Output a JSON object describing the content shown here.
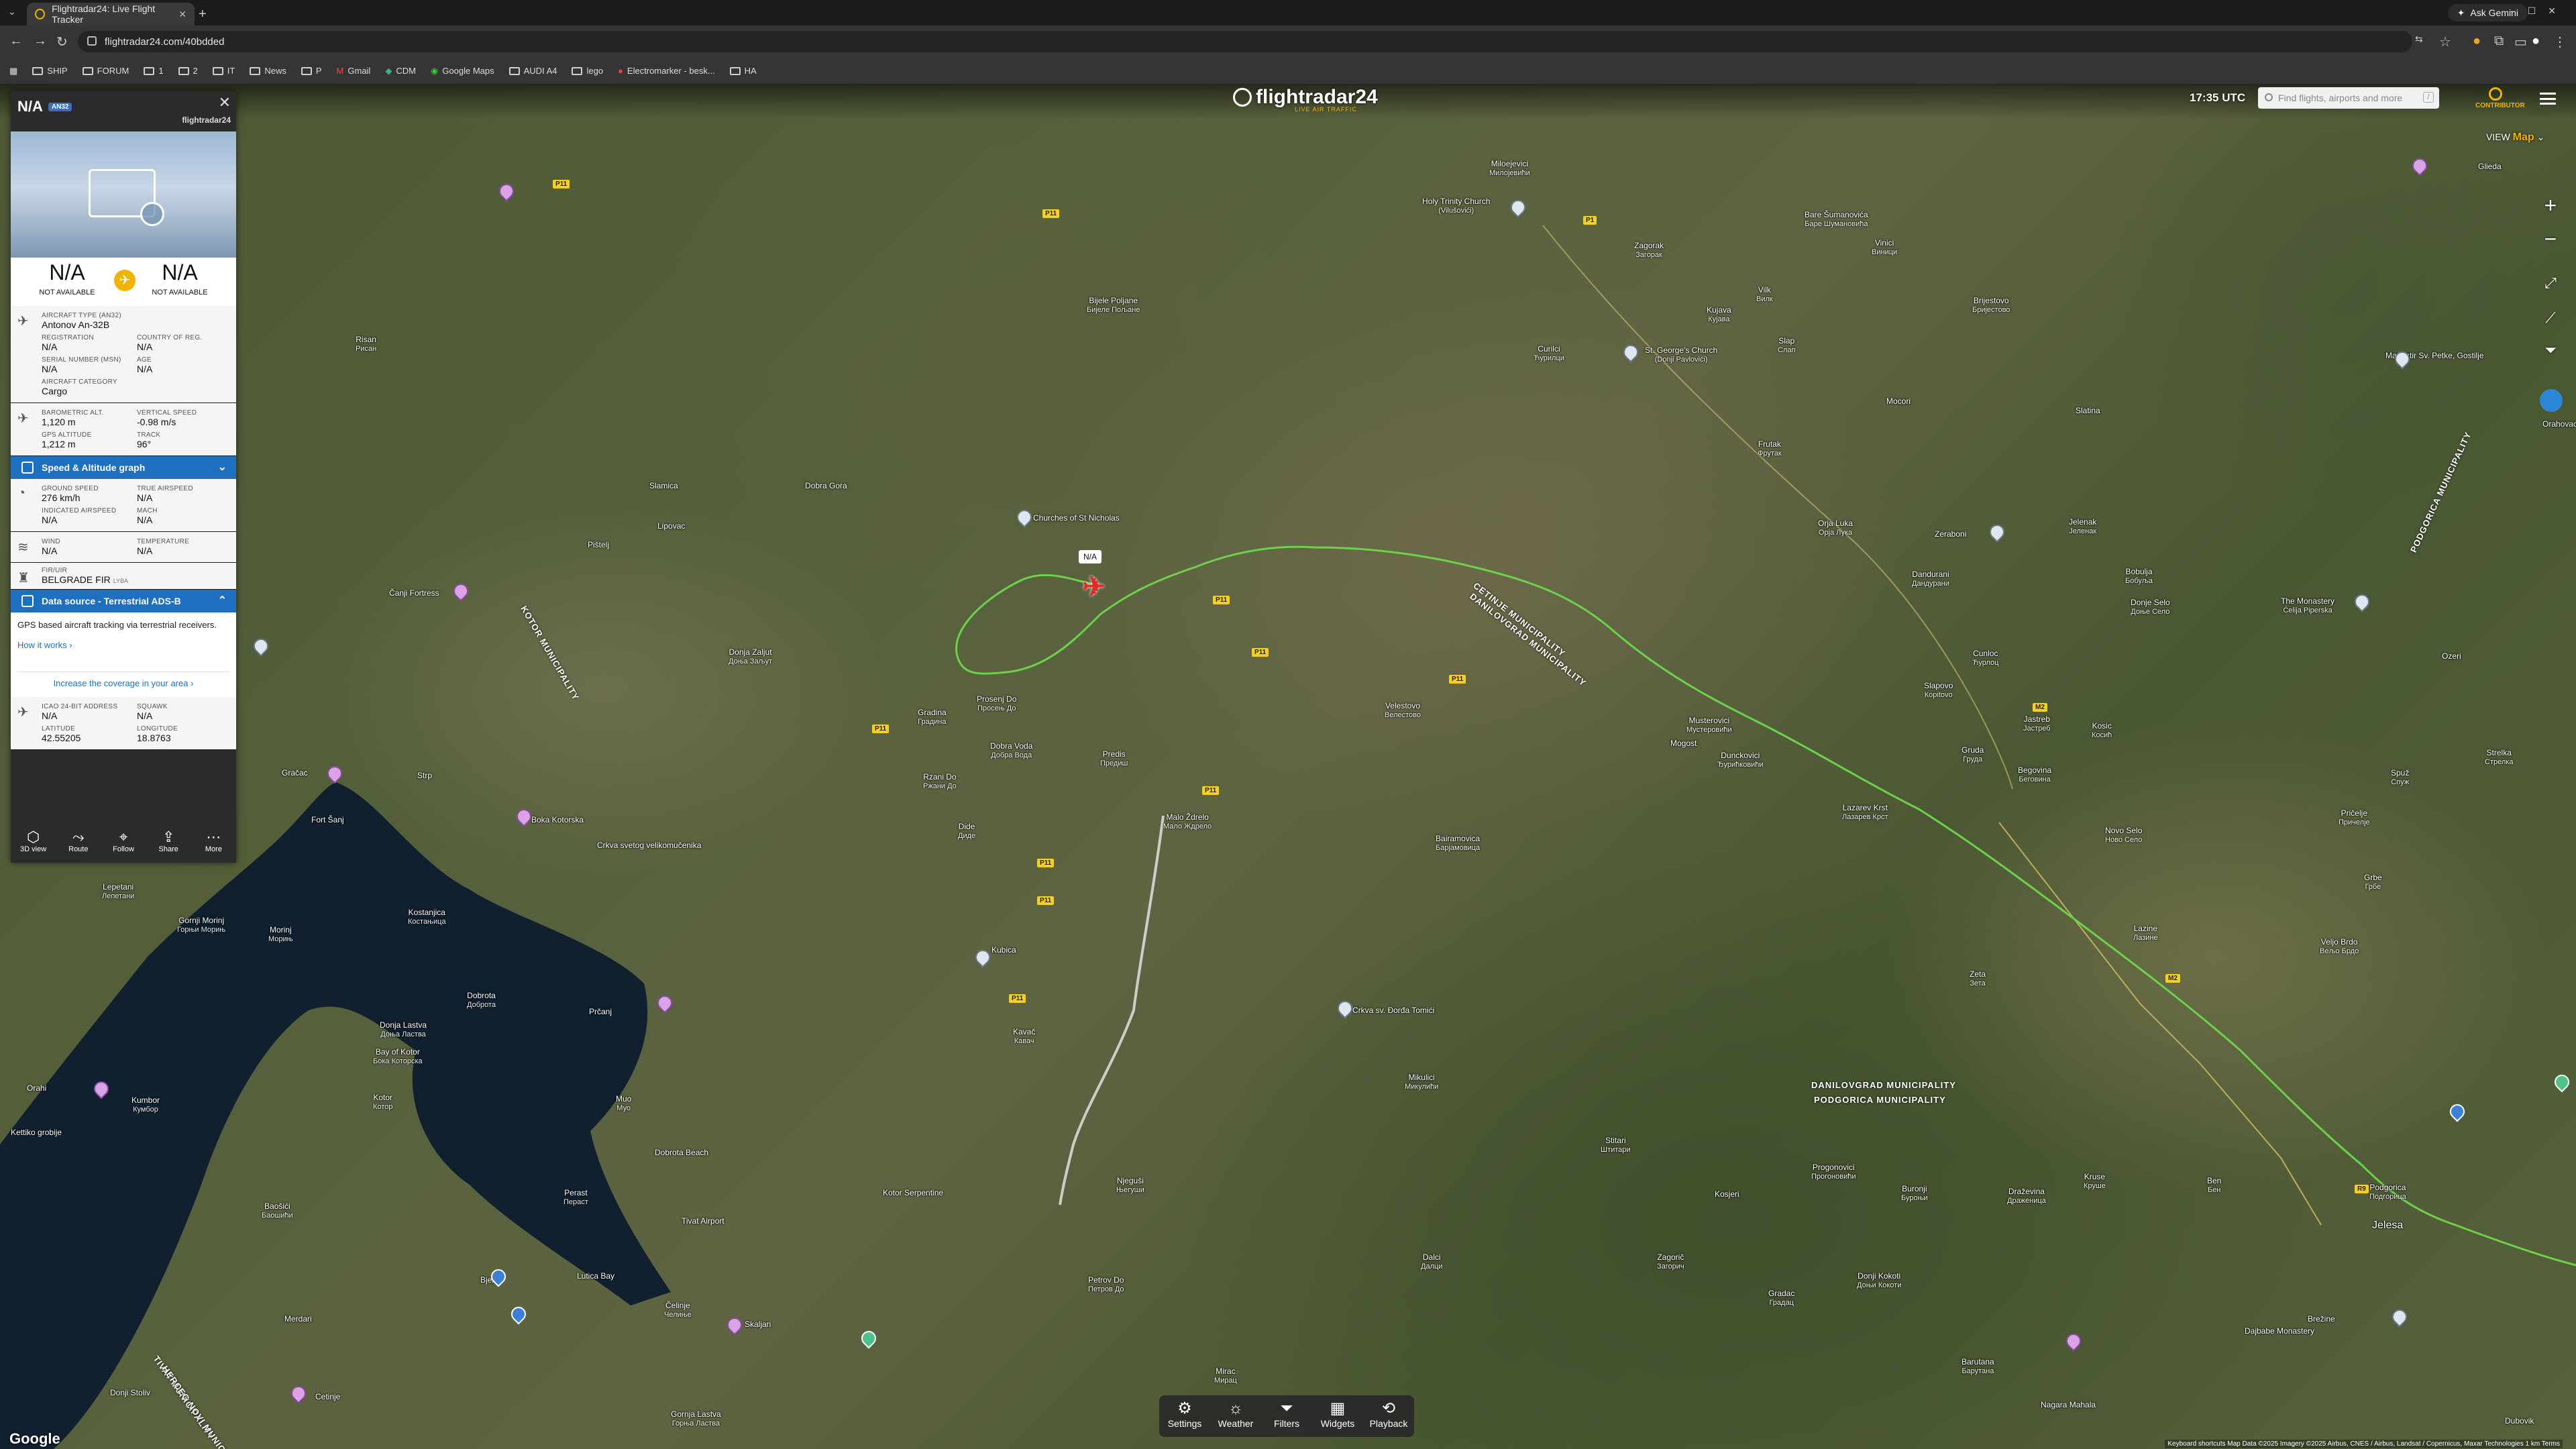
{
  "browser": {
    "tab_title": "Flightradar24: Live Flight Tracker",
    "url": "flightradar24.com/40bdded",
    "ask_gemini": "Ask Gemini",
    "bookmarks": [
      "SHIP",
      "FORUM",
      "1",
      "2",
      "IT",
      "News",
      "P",
      "Gmail",
      "CDM",
      "Google Maps",
      "AUDI A4",
      "lego",
      "Electromarker - besk...",
      "HA"
    ]
  },
  "topbar": {
    "logo": "flightradar24",
    "logo_sub": "LIVE AIR TRAFFIC",
    "clock": "17:35 UTC",
    "search_placeholder": "Find flights, airports and more",
    "search_shortcut": "/",
    "contributor": "CONTRIBUTOR",
    "view_label": "VIEW",
    "view_value": "Map"
  },
  "panel": {
    "callsign": "N/A",
    "type_badge": "AN32",
    "brand": "flightradar24",
    "origin_code": "N/A",
    "origin_sub": "NOT AVAILABLE",
    "dest_code": "N/A",
    "dest_sub": "NOT AVAILABLE",
    "aircraft_type_label": "AIRCRAFT TYPE (AN32)",
    "aircraft_type_value": "Antonov An-32B",
    "registration_label": "REGISTRATION",
    "registration_value": "N/A",
    "country_label": "COUNTRY OF REG.",
    "country_value": "N/A",
    "serial_label": "SERIAL NUMBER (MSN)",
    "serial_value": "N/A",
    "age_label": "AGE",
    "age_value": "N/A",
    "category_label": "AIRCRAFT CATEGORY",
    "category_value": "Cargo",
    "baro_label": "BAROMETRIC ALT.",
    "baro_value": "1,120 m",
    "vspeed_label": "VERTICAL SPEED",
    "vspeed_value": "-0.98 m/s",
    "gpsalt_label": "GPS ALTITUDE",
    "gpsalt_value": "1,212 m",
    "track_label": "TRACK",
    "track_value": "96°",
    "graph_bar": "Speed & Altitude graph",
    "gs_label": "GROUND SPEED",
    "gs_value": "276 km/h",
    "tas_label": "TRUE AIRSPEED",
    "tas_value": "N/A",
    "ias_label": "INDICATED AIRSPEED",
    "ias_value": "N/A",
    "mach_label": "MACH",
    "mach_value": "N/A",
    "wind_label": "WIND",
    "wind_value": "N/A",
    "temp_label": "TEMPERATURE",
    "temp_value": "N/A",
    "fir_label": "FIR/UIR",
    "fir_value": "BELGRADE FIR",
    "fir_code": "LYBA",
    "ds_bar": "Data source - Terrestrial ADS-B",
    "ds_text": "GPS based aircraft tracking via terrestrial receivers.",
    "ds_how": "How it works",
    "ds_increase": "Increase the coverage in your area",
    "icao_label": "ICAO 24-BIT ADDRESS",
    "icao_value": "N/A",
    "squawk_label": "SQUAWK",
    "squawk_value": "N/A",
    "lat_label": "LATITUDE",
    "lat_value": "42.55205",
    "lon_label": "LONGITUDE",
    "lon_value": "18.8763",
    "actions": [
      "3D view",
      "Route",
      "Follow",
      "Share",
      "More"
    ]
  },
  "aircraft_label": "N/A",
  "toolbar": [
    "Settings",
    "Weather",
    "Filters",
    "Widgets",
    "Playback"
  ],
  "map_labels": {
    "google": "Google",
    "attribution": "Keyboard shortcuts   Map Data ©2025 Imagery ©2025 Airbus, CNES / Airbus, Landsat / Copernicus, Maxar Technologies   1 km   Terms",
    "places": [
      [
        "Miloejevici",
        "Милојевићи"
      ],
      [
        "Holy Trinity Church",
        "(Vilušovići)"
      ],
      [
        "Zagorak",
        "Загорак"
      ],
      [
        "Bare Šumanovića",
        "Баре Шумановића"
      ],
      [
        "Vinici",
        "Виници"
      ],
      [
        "Bijele Poljane",
        "Бијеле Пољане"
      ],
      [
        "Kujava",
        "Кујава"
      ],
      [
        "Vilk",
        "Вилк"
      ],
      [
        "Curilci",
        "Ћурилци"
      ],
      [
        "St. George's Church",
        "(Donji Pavlovići)"
      ],
      [
        "Slap",
        "Слап"
      ],
      [
        "Brijestovo",
        "Бријестово"
      ],
      [
        "Mocori",
        ""
      ],
      [
        "Slatina",
        ""
      ],
      [
        "Frutak",
        "Фрутак"
      ],
      [
        "Churches of St Nicholas",
        ""
      ],
      [
        "Dobra Gora",
        ""
      ],
      [
        "Slamica",
        ""
      ],
      [
        "Lipovac",
        ""
      ],
      [
        "Pištelj",
        ""
      ],
      [
        "Čanji Fortress",
        ""
      ],
      [
        "Donja Zaljut",
        "Доња Заљут"
      ],
      [
        "Gradina",
        "Градина"
      ],
      [
        "Prosenj Do",
        "Просењ До"
      ],
      [
        "Predis",
        "Предиш"
      ],
      [
        "Dobra Voda",
        "Добра Вода"
      ],
      [
        "Velestovo",
        "Велестово"
      ],
      [
        "Mogost",
        ""
      ],
      [
        "Musterovici",
        "Мустеровићи"
      ],
      [
        "Dunckovici",
        "Ђурићковићи"
      ],
      [
        "Orja Luka",
        "Орја Лука"
      ],
      [
        "Zeraboni",
        ""
      ],
      [
        "Dandurani",
        "Дандурани"
      ],
      [
        "Bobulja",
        "Бобуља"
      ],
      [
        "Jelenak",
        "Јеленак"
      ],
      [
        "Donje Selo",
        "Доње Село"
      ],
      [
        "Cunloc",
        "Ћурлоц"
      ],
      [
        "Slapovo",
        "Кopitovo"
      ],
      [
        "Jastreb",
        "Јастреб"
      ],
      [
        "Kosic",
        "Косић"
      ],
      [
        "Gruda",
        "Груда"
      ],
      [
        "Begovina",
        "Беговина"
      ],
      [
        "The Monastery",
        "Ćelija Piperska"
      ],
      [
        "Ozeri",
        ""
      ],
      [
        "Strelka",
        "Стрелка"
      ],
      [
        "Rzani Do",
        "Ржани До"
      ],
      [
        "Malo Ždrelo",
        "Мало Ждрело"
      ],
      [
        "Dide",
        "Диде"
      ],
      [
        "Bairamovica",
        "Барјамовица"
      ],
      [
        "Lazarev Krst",
        "Лазарев Крст"
      ],
      [
        "Pričelje",
        "Причелје"
      ],
      [
        "Spuž",
        "Спуж"
      ],
      [
        "Novo Selo",
        "Ново Село"
      ],
      [
        "Grbe",
        "Грбе"
      ],
      [
        "Lazine",
        "Лазине"
      ],
      [
        "Veljo Brdo",
        "Вељо Брдо"
      ],
      [
        "Zeta",
        "Зета"
      ],
      [
        "Glieda",
        ""
      ],
      [
        "Manastir Sv. Petke, Gostilje",
        ""
      ],
      [
        "Orahovac",
        ""
      ],
      [
        "Crkva sv. Đorđa Tomići",
        ""
      ],
      [
        "Mikulici",
        "Микулићи"
      ],
      [
        "Stitari",
        "Штитари"
      ],
      [
        "Progonovici",
        "Прогоновићи"
      ],
      [
        "Buronji",
        "Буроњи"
      ],
      [
        "Draževina",
        "Драженица"
      ],
      [
        "Kruse",
        "Круше"
      ],
      [
        "Ben",
        "Бен"
      ],
      [
        "Podgorica",
        "Подгорица"
      ],
      [
        "Jelesa",
        ""
      ],
      [
        "Kosjeri",
        "Косијери"
      ],
      [
        "Dalci",
        "Далци"
      ],
      [
        "Zagorič",
        "Загорич"
      ],
      [
        "Gradac",
        "Градац"
      ],
      [
        "Donji Kokoti",
        "Доњи Кокоти"
      ],
      [
        "Dajbabe Monastery",
        ""
      ],
      [
        "Brežine",
        "Брежине"
      ],
      [
        "Barutana",
        "Барутана"
      ],
      [
        "Nagara Mahala",
        ""
      ],
      [
        "Dubovik",
        "Дубовик"
      ],
      [
        "Petrov Do",
        "Петров До"
      ],
      [
        "Njeguši",
        "Његуши"
      ],
      [
        "Kotor Serpentine",
        ""
      ],
      [
        "Skaljari",
        "Шкаљари"
      ],
      [
        "Čelinje",
        "Челиње"
      ],
      [
        "Mirac",
        "Мирац"
      ],
      [
        "Gornja Lastva",
        "Горња Ластва"
      ],
      [
        "Kotor",
        "Котор"
      ],
      [
        "Tivat Airport",
        ""
      ],
      [
        "Bjelila",
        "Бјелила"
      ],
      [
        "Merdari",
        ""
      ],
      [
        "Donji Stoliv",
        "Доњи Столив"
      ],
      [
        "Dobrota",
        "Доброта"
      ],
      [
        "Dobrota Beach",
        ""
      ],
      [
        "Prčanj",
        "Прчањ"
      ],
      [
        "Muo",
        "Муо"
      ],
      [
        "Perast",
        "Пераст"
      ],
      [
        "Kostanjica",
        "Костањица"
      ],
      [
        "Morinj",
        "Морињ"
      ],
      [
        "Gornji Morinj",
        "Горњи Морињ"
      ],
      [
        "Lepetani",
        "Лепетани"
      ],
      [
        "Donja Lastva",
        "Доња Ластва"
      ],
      [
        "Bay of Kotor",
        "Бока Которска"
      ],
      [
        "Baošići",
        "Баошићи"
      ],
      [
        "Kumbor",
        "Кумбор"
      ],
      [
        "Kettiko grobije",
        ""
      ],
      [
        "Orahi",
        "Ораси"
      ],
      [
        "Risan",
        "Рисан"
      ],
      [
        "Strp",
        ""
      ],
      [
        "Fort Šanj",
        ""
      ],
      [
        "Boka Kotorska",
        ""
      ],
      [
        "Gračac",
        ""
      ],
      [
        "Crkva svetog velikomučenika",
        ""
      ],
      [
        "Kubica",
        "Кубица"
      ],
      [
        "Kavač",
        "Кавач"
      ],
      [
        "Lutica Bay",
        ""
      ],
      [
        "Cetinje",
        ""
      ]
    ],
    "municipalities": [
      "CETINJE MUNICIPALITY",
      "KOTOR MUNICIPALITY",
      "DANILOVGRAD MUNICIPALITY",
      "PODGORICA MUNICIPALITY",
      "TIVAT MUNICIPALITY",
      "HERCEG NOVI MUNICIPALITY",
      "DANILOVGRAD MUNICIPALITY",
      "PODGORICA MUNICIPALITY"
    ],
    "roads": [
      "P11",
      "P11",
      "P11",
      "P11",
      "P11",
      "P11",
      "P11",
      "P11",
      "P11",
      "P11",
      "M2",
      "M2",
      "P1",
      "R9"
    ]
  }
}
